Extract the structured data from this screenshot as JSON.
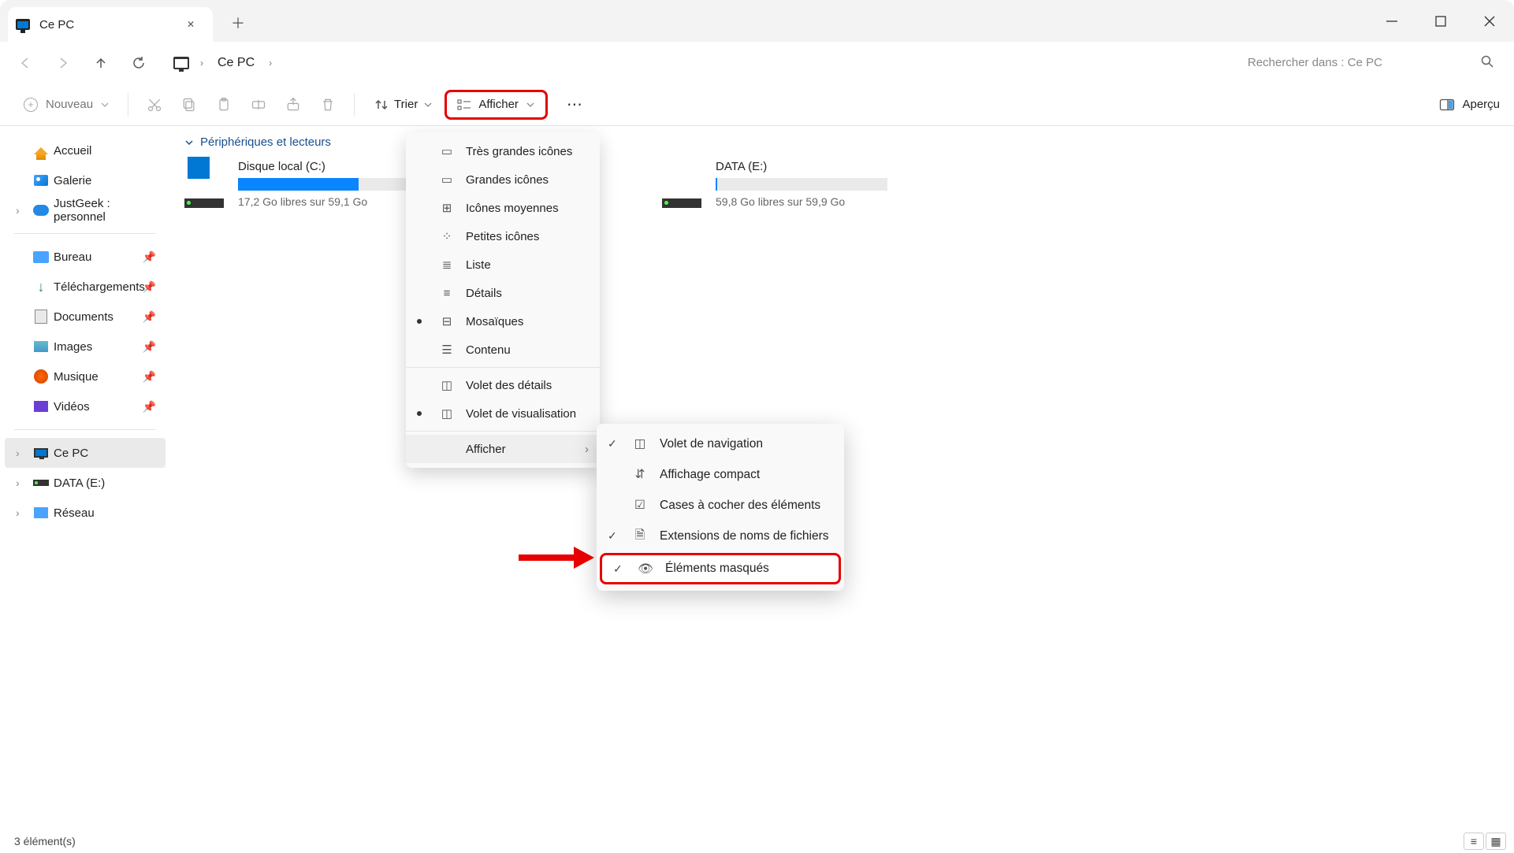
{
  "tab": {
    "title": "Ce PC"
  },
  "breadcrumb": {
    "segment": "Ce PC"
  },
  "search": {
    "placeholder": "Rechercher dans : Ce PC"
  },
  "toolbar": {
    "new_label": "Nouveau",
    "sort_label": "Trier",
    "view_label": "Afficher",
    "preview_label": "Aperçu"
  },
  "sidebar": {
    "home": "Accueil",
    "gallery": "Galerie",
    "onedrive": "JustGeek : personnel",
    "desktop": "Bureau",
    "downloads": "Téléchargements",
    "documents": "Documents",
    "pictures": "Images",
    "music": "Musique",
    "videos": "Vidéos",
    "this_pc": "Ce PC",
    "data_e": "DATA (E:)",
    "network": "Réseau"
  },
  "content": {
    "group_header": "Périphériques et lecteurs",
    "drives": [
      {
        "name": "Disque local (C:)",
        "free_text": "17,2 Go libres sur 59,1 Go",
        "fill_pct": 70
      },
      {
        "name": "DATA (E:)",
        "free_text": "59,8 Go libres sur 59,9 Go",
        "fill_pct": 1
      }
    ]
  },
  "menu1": {
    "items": [
      "Très grandes icônes",
      "Grandes icônes",
      "Icônes moyennes",
      "Petites icônes",
      "Liste",
      "Détails",
      "Mosaïques",
      "Contenu",
      "Volet des détails",
      "Volet de visualisation",
      "Afficher"
    ]
  },
  "menu2": {
    "items": [
      "Volet de navigation",
      "Affichage compact",
      "Cases à cocher des éléments",
      "Extensions de noms de fichiers",
      "Éléments masqués"
    ]
  },
  "status": {
    "count": "3 élément(s)"
  }
}
